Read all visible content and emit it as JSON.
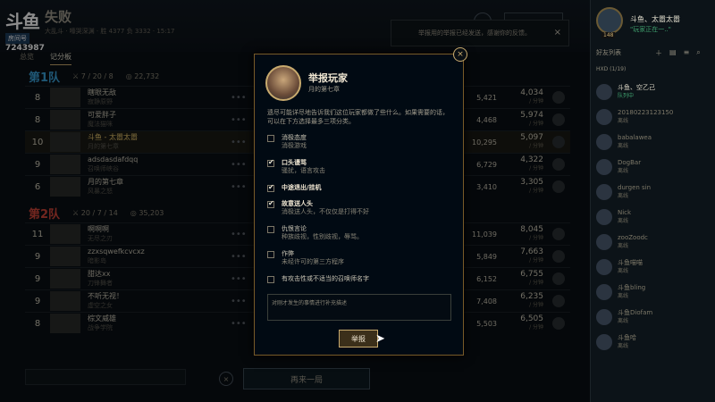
{
  "watermark": {
    "logo": "斗鱼",
    "room_label": "房间号",
    "room_id": "7243987"
  },
  "header": {
    "result": "失败",
    "subtitle": "大乱斗 · 嚎哭深渊 · 胜 4377 负 3332 · 15:17"
  },
  "tabs": [
    {
      "label": "总览"
    },
    {
      "label": "记分板"
    }
  ],
  "notification": {
    "text": "举报用的举报已经发送，感谢你的反馈。",
    "close": "×"
  },
  "teams": [
    {
      "name": "第1队",
      "name_color": "#3aa0d8",
      "kda": "7 / 20 / 8",
      "gold": "22,732",
      "players": [
        {
          "level": "8",
          "name": "瞎眼无敌",
          "sub": "寂静原野",
          "damage": "5,421",
          "gold": "4,034"
        },
        {
          "level": "8",
          "name": "可爱胖子",
          "sub": "魔法猫咪",
          "damage": "4,468",
          "gold": "5,974"
        },
        {
          "level": "10",
          "name": "斗鱼 - 太嚣太嚣",
          "sub": "月的第七章",
          "damage": "10,295",
          "gold": "5,097"
        },
        {
          "level": "9",
          "name": "adsdasdafdqq",
          "sub": "召唤师峡谷",
          "damage": "6,729",
          "gold": "4,322"
        },
        {
          "level": "6",
          "name": "月的第七章",
          "sub": "风暴之怒",
          "damage": "3,410",
          "gold": "3,305"
        }
      ]
    },
    {
      "name": "第2队",
      "name_color": "#d0463a",
      "kda": "20 / 7 / 14",
      "gold": "35,203",
      "players": [
        {
          "level": "11",
          "name": "啊啊啊",
          "sub": "无尽之刃",
          "damage": "11,039",
          "gold": "8,045"
        },
        {
          "level": "9",
          "name": "zzxsqwefkcvcxz",
          "sub": "暗影岛",
          "damage": "5,849",
          "gold": "7,663"
        },
        {
          "level": "9",
          "name": "甜达xx",
          "sub": "刀锋舞者",
          "damage": "6,152",
          "gold": "6,755"
        },
        {
          "level": "9",
          "name": "不听无视！",
          "sub": "虚空之女",
          "damage": "7,408",
          "gold": "6,235"
        },
        {
          "level": "8",
          "name": "棕文威雄",
          "sub": "战争学院",
          "damage": "5,503",
          "gold": "6,505"
        }
      ]
    }
  ],
  "gold_suffix": "/ 分钟",
  "bottom": {
    "play_again": "再来一局",
    "close": "×"
  },
  "modal": {
    "title": "举报玩家",
    "player": "月的第七章",
    "description": "遗尽可能详尽地告诉我们这位玩家都做了些什么。如果需要的话，可以在下方选择最多三项分类。",
    "options": [
      {
        "title": "消极态度",
        "sub": "消极游戏",
        "checked": false
      },
      {
        "title": "口头谩骂",
        "sub": "骚扰，语言攻击",
        "checked": true
      },
      {
        "title": "中途退出/挂机",
        "sub": "",
        "checked": true
      },
      {
        "title": "故意送人头",
        "sub": "消极送人头，不仅仅是打得不好",
        "checked": true
      },
      {
        "title": "仇恨言论",
        "sub": "种族歧视，性别歧视，辱骂。",
        "checked": false
      },
      {
        "title": "作弊",
        "sub": "未经许可的第三方程序",
        "checked": false
      },
      {
        "title": "有攻击性或不适当的召唤师名字",
        "sub": "",
        "checked": false
      }
    ],
    "textarea_placeholder": "对刚才发生的事情进行补充描述",
    "submit": "举报",
    "close": "×"
  },
  "sidebar": {
    "user_name": "斗鱼、太嚣太嚣",
    "user_status": "\"玩家正在一..\"",
    "level": "148",
    "section": "好友列表",
    "group": "HXD (1/19)",
    "friends": [
      {
        "name": "斗鱼、空乙己",
        "status": "队列中",
        "online": true
      },
      {
        "name": "20180223123150",
        "status": "离线",
        "online": false
      },
      {
        "name": "babalawea",
        "status": "离线",
        "online": false
      },
      {
        "name": "DogBar",
        "status": "离线",
        "online": false
      },
      {
        "name": "durgen sin",
        "status": "离线",
        "online": false
      },
      {
        "name": "Nick",
        "status": "离线",
        "online": false
      },
      {
        "name": "zooZoodc",
        "status": "离线",
        "online": false
      },
      {
        "name": "斗鱼喵喵",
        "status": "离线",
        "online": false
      },
      {
        "name": "斗鱼bling",
        "status": "离线",
        "online": false
      },
      {
        "name": "斗鱼Diofam",
        "status": "离线",
        "online": false
      },
      {
        "name": "斗鱼哈",
        "status": "离线",
        "online": false
      }
    ]
  }
}
